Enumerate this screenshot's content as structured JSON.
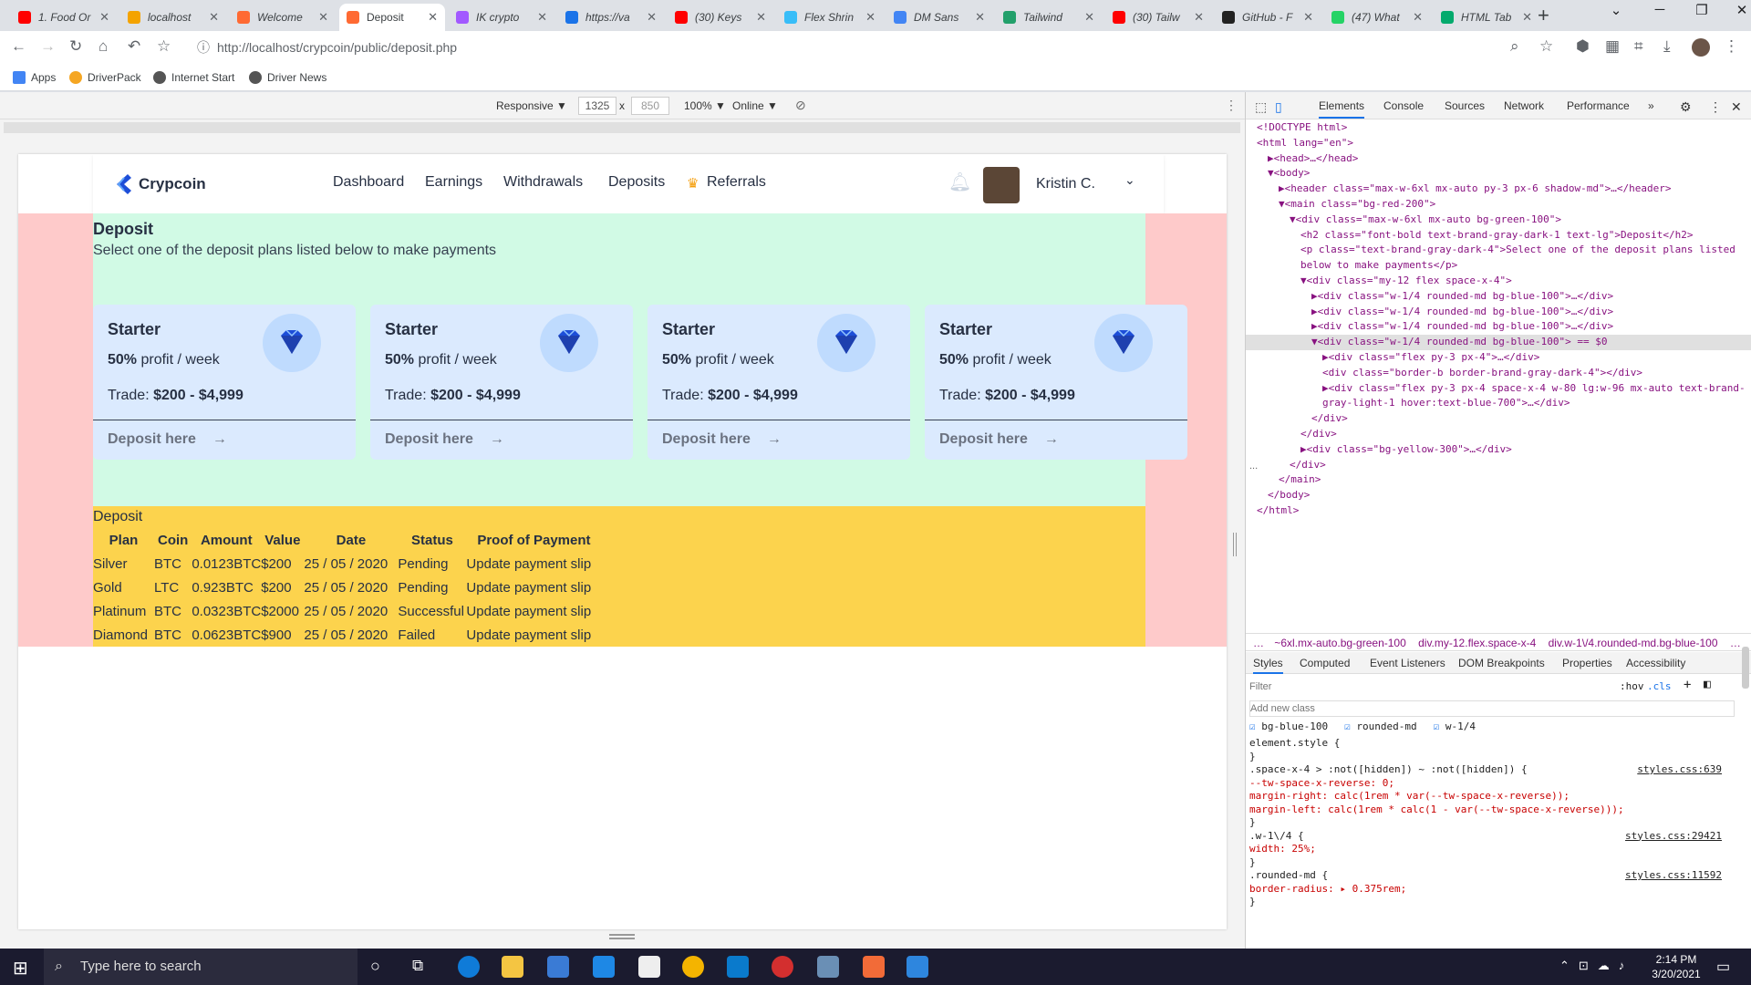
{
  "browser": {
    "tabs": [
      {
        "title": "1. Food Or",
        "color": "#ff0000"
      },
      {
        "title": "localhost",
        "color": "#f4a300"
      },
      {
        "title": "Welcome",
        "color": "#ff6a33"
      },
      {
        "title": "Deposit",
        "color": "#ff6a33",
        "active": true
      },
      {
        "title": "IK crypto",
        "color": "#a259ff"
      },
      {
        "title": "https://va",
        "color": "#1a73e8"
      },
      {
        "title": "(30) Keys",
        "color": "#ff0000"
      },
      {
        "title": "Flex Shrin",
        "color": "#38bdf8"
      },
      {
        "title": "DM Sans",
        "color": "#4285f4"
      },
      {
        "title": "Tailwind",
        "color": "#22a06b"
      },
      {
        "title": "(30) Tailw",
        "color": "#ff0000"
      },
      {
        "title": "GitHub - F",
        "color": "#222222"
      },
      {
        "title": "(47) What",
        "color": "#25d366"
      },
      {
        "title": "HTML Tab",
        "color": "#04aa6d"
      }
    ],
    "tab_close": "✕",
    "new_tab": "+",
    "url": "http://localhost/crypcoin/public/deposit.php",
    "bookmarks": [
      "Apps",
      "DriverPack",
      "Internet Start",
      "Driver News"
    ]
  },
  "device_toolbar": {
    "mode": "Responsive ▼",
    "width": "1325",
    "times": "x",
    "height": "850",
    "zoom": "100% ▼",
    "network": "Online ▼"
  },
  "site": {
    "logo_text": "Crypcoin",
    "nav": [
      "Dashboard",
      "Earnings",
      "Withdrawals",
      "Deposits",
      "Referrals"
    ],
    "user_name": "Kristin C.",
    "heading": "Deposit",
    "subheading": "Select one of the deposit plans listed below to make payments",
    "cards": [
      {
        "title": "Starter",
        "profit_bold": "50%",
        "profit_rest": " profit / week",
        "trade_label": "Trade: ",
        "trade_value": "$200 - $4,999",
        "cta": "Deposit here",
        "arrow": "→"
      },
      {
        "title": "Starter",
        "profit_bold": "50%",
        "profit_rest": " profit / week",
        "trade_label": "Trade: ",
        "trade_value": "$200 - $4,999",
        "cta": "Deposit here",
        "arrow": "→"
      },
      {
        "title": "Starter",
        "profit_bold": "50%",
        "profit_rest": " profit / week",
        "trade_label": "Trade: ",
        "trade_value": "$200 - $4,999",
        "cta": "Deposit here",
        "arrow": "→"
      },
      {
        "title": "Starter",
        "profit_bold": "50%",
        "profit_rest": " profit / week",
        "trade_label": "Trade: ",
        "trade_value": "$200 - $4,999",
        "cta": "Deposit here",
        "arrow": "→"
      }
    ],
    "table_caption": "Deposit",
    "table_headers": [
      "Plan",
      "Coin",
      "Amount",
      "Value",
      "Date",
      "Status",
      "Proof of Payment"
    ],
    "table_rows": [
      [
        "Silver",
        "BTC",
        "0.0123BTC",
        "$200",
        "25 / 05 / 2020",
        "Pending",
        "Update payment slip"
      ],
      [
        "Gold",
        "LTC",
        "0.923BTC",
        "$200",
        "25 / 05 / 2020",
        "Pending",
        "Update payment slip"
      ],
      [
        "Platinum",
        "BTC",
        "0.0323BTC",
        "$2000",
        "25 / 05 / 2020",
        "Successful",
        "Update payment slip"
      ],
      [
        "Diamond",
        "BTC",
        "0.0623BTC",
        "$900",
        "25 / 05 / 2020",
        "Failed",
        "Update payment slip"
      ]
    ]
  },
  "devtools": {
    "tabs": [
      "Elements",
      "Console",
      "Sources",
      "Network",
      "Performance",
      "»"
    ],
    "dom_lines": [
      "<!DOCTYPE html>",
      "<html lang=\"en\">",
      "▶<head>…</head>",
      "▼<body>",
      "▶<header class=\"max-w-6xl mx-auto py-3 px-6 shadow-md\">…</header>",
      "▼<main class=\"bg-red-200\">",
      "▼<div class=\"max-w-6xl mx-auto bg-green-100\">",
      "<h2 class=\"font-bold text-brand-gray-dark-1 text-lg\">Deposit</h2>",
      "<p class=\"text-brand-gray-dark-4\">Select one of the deposit plans listed",
      "below to make payments</p>",
      "▼<div class=\"my-12 flex space-x-4\">",
      "▶<div class=\"w-1/4 rounded-md bg-blue-100\">…</div>",
      "▶<div class=\"w-1/4 rounded-md bg-blue-100\">…</div>",
      "▶<div class=\"w-1/4 rounded-md bg-blue-100\">…</div>",
      "▼<div class=\"w-1/4 rounded-md bg-blue-100\"> == $0",
      "▶<div class=\"flex py-3 px-4\">…</div>",
      "<div class=\"border-b border-brand-gray-dark-4\"></div>",
      "▶<div class=\"flex py-3 px-4 space-x-4 w-80 lg:w-96 mx-auto text-brand-",
      "gray-light-1 hover:text-blue-700\">…</div>",
      "</div>",
      "</div>",
      "▶<div class=\"bg-yellow-300\">…</div>",
      "</div>",
      "</main>",
      "</body>",
      "</html>"
    ],
    "dom_ellipsis": "...",
    "breadcrumbs": [
      "…",
      "~6xl.mx-auto.bg-green-100",
      "div.my-12.flex.space-x-4",
      "div.w-1\\/4.rounded-md.bg-blue-100",
      "…"
    ],
    "subtabs": [
      "Styles",
      "Computed",
      "Event Listeners",
      "DOM Breakpoints",
      "Properties",
      "Accessibility"
    ],
    "filter_placeholder": "Filter",
    "hov": ":hov",
    "cls": ".cls",
    "new_class_placeholder": "Add new class",
    "classes": [
      "bg-blue-100",
      "rounded-md",
      "w-1/4"
    ],
    "style_lines": [
      {
        "t": "element.style {"
      },
      {
        "t": "}"
      },
      {
        "t": ".space-x-4 > :not([hidden]) ~ :not([hidden]) {",
        "link": "styles.css:639"
      },
      {
        "t": "  --tw-space-x-reverse: 0;",
        "prop": true
      },
      {
        "t": "  margin-right: calc(1rem * var(--tw-space-x-reverse));",
        "prop": true
      },
      {
        "t": "  margin-left: calc(1rem * calc(1 - var(--tw-space-x-reverse)));",
        "prop": true
      },
      {
        "t": "}"
      },
      {
        "t": ".w-1\\/4 {",
        "link": "styles.css:29421"
      },
      {
        "t": "  width: 25%;",
        "prop": true
      },
      {
        "t": "}"
      },
      {
        "t": ".rounded-md {",
        "link": "styles.css:11592"
      },
      {
        "t": "  border-radius: ▸ 0.375rem;",
        "prop": true
      },
      {
        "t": "}"
      }
    ]
  },
  "taskbar": {
    "search_placeholder": "Type here to search",
    "time": "2:14 PM",
    "date": "3/20/2021"
  }
}
